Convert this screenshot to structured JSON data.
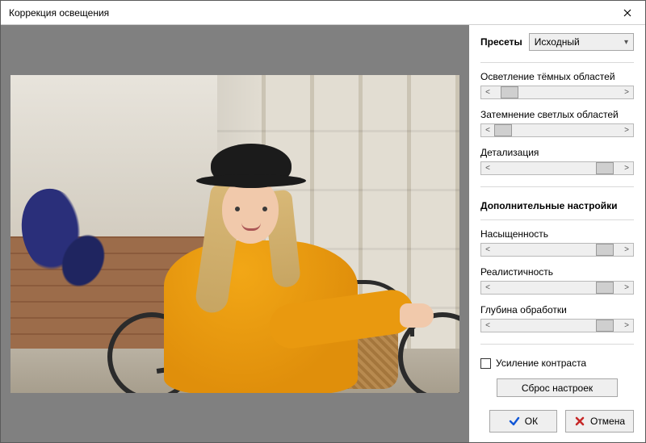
{
  "window": {
    "title": "Коррекция освещения"
  },
  "presets": {
    "label": "Пресеты",
    "selected": "Исходный"
  },
  "sliders": {
    "fill_light": {
      "label": "Осветление тёмных областей",
      "pos": 12
    },
    "darken_high": {
      "label": "Затемнение светлых областей",
      "pos": 0
    },
    "detail": {
      "label": "Детализация",
      "pos": 88
    }
  },
  "advanced_title": "Дополнительные настройки",
  "adv_sliders": {
    "saturation": {
      "label": "Насыщенность",
      "pos": 88
    },
    "realism": {
      "label": "Реалистичность",
      "pos": 88
    },
    "depth": {
      "label": "Глубина обработки",
      "pos": 88
    }
  },
  "contrast_boost": {
    "label": "Усиление контраста",
    "checked": false
  },
  "reset": {
    "label": "Сброс настроек"
  },
  "buttons": {
    "ok": "ОК",
    "cancel": "Отмена"
  }
}
